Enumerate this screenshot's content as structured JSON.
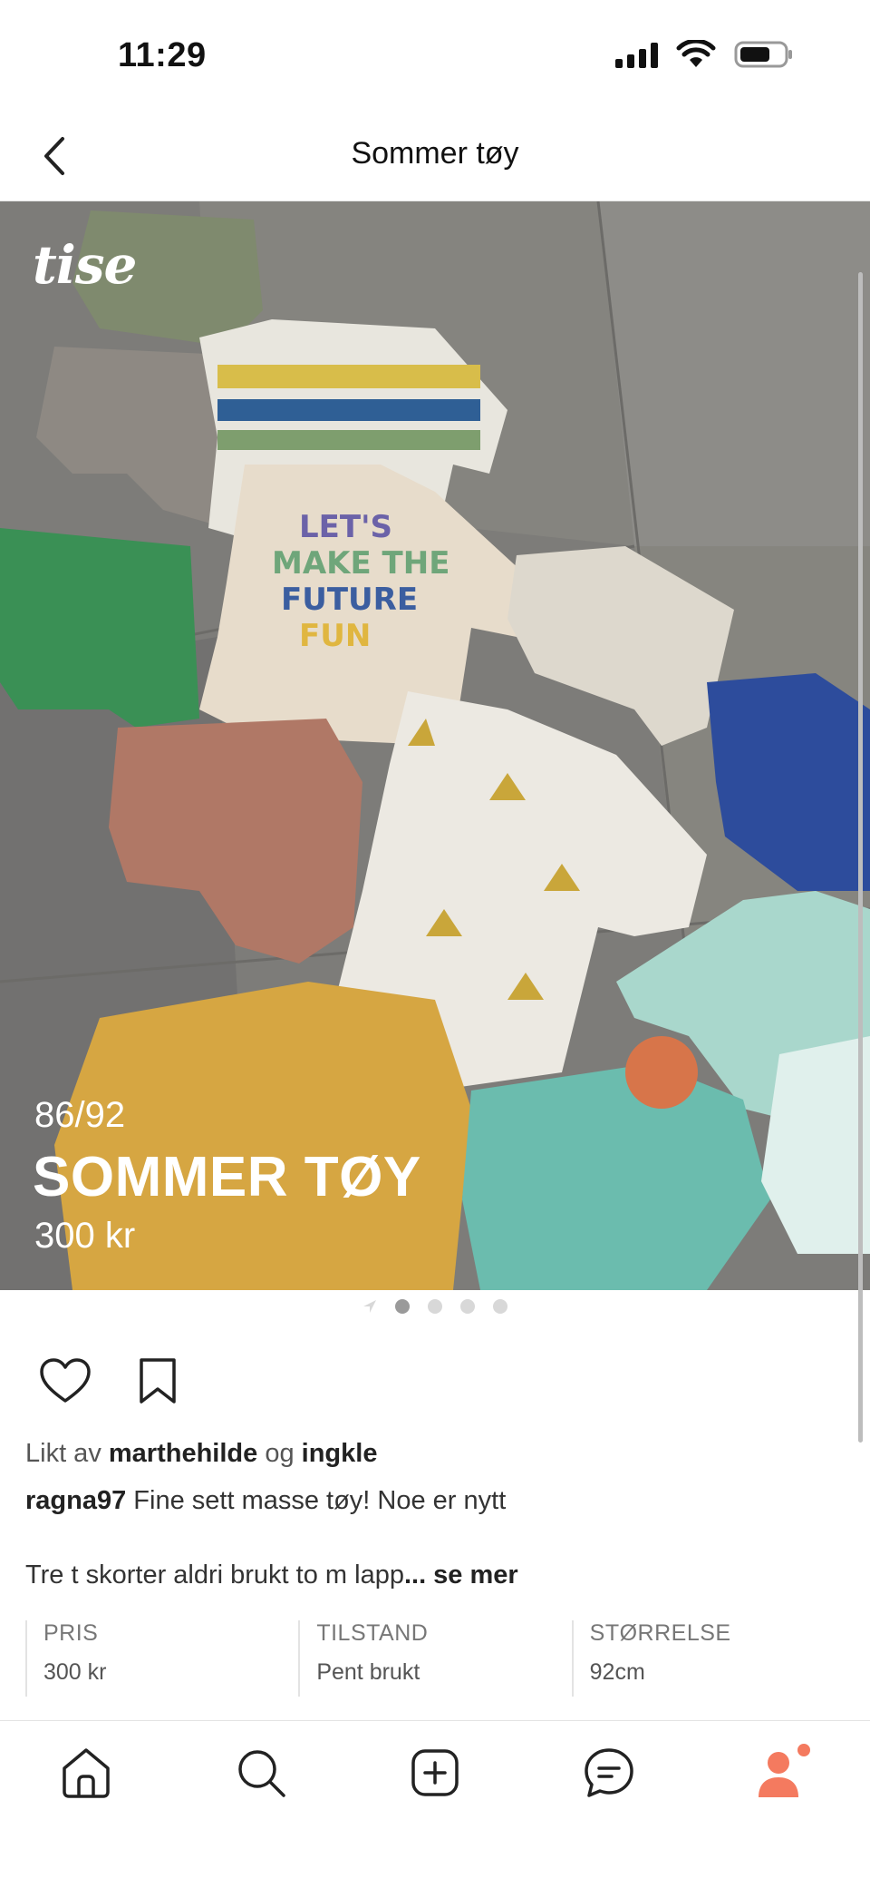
{
  "status_bar": {
    "time": "11:29",
    "icons": [
      "signal-icon",
      "wifi-icon",
      "battery-icon"
    ]
  },
  "header": {
    "title": "Sommer tøy",
    "back_icon": "chevron-left-icon"
  },
  "listing": {
    "logo": "tise",
    "size": "86/92",
    "title": "SOMMER TØY",
    "price": "300 kr",
    "image_count": 4,
    "active_image_index": 0
  },
  "social": {
    "liked_prefix": "Likt av",
    "liked_user_1": "marthehilde",
    "liked_and": "og",
    "liked_user_2": "ingkle",
    "seller": "ragna97",
    "caption": "Fine sett masse tøy! Noe er nytt",
    "description": "Tre t skorter aldri brukt to m lapp",
    "see_more": "... se mer"
  },
  "details": [
    {
      "label": "PRIS",
      "value": "300 kr"
    },
    {
      "label": "TILSTAND",
      "value": "Pent brukt"
    },
    {
      "label": "STØRRELSE",
      "value": "92cm"
    }
  ],
  "tabbar": {
    "tabs": [
      "home-icon",
      "search-icon",
      "add-icon",
      "messages-icon",
      "profile-icon"
    ],
    "accent": "#f47a5f"
  }
}
